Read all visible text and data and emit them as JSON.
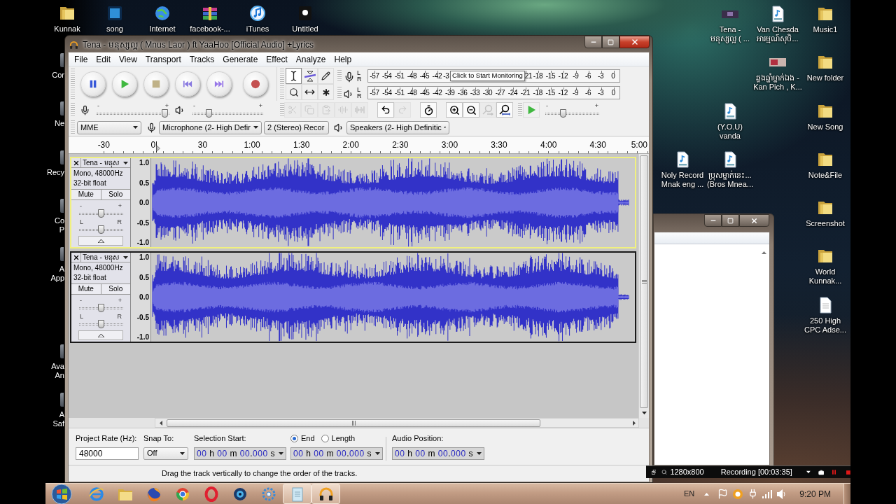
{
  "desktop": {
    "top_icons": [
      {
        "lines": [
          "Kunnak"
        ],
        "kind": "folder"
      },
      {
        "lines": [
          "song"
        ],
        "kind": "ps"
      },
      {
        "lines": [
          "Internet"
        ],
        "kind": "globe"
      },
      {
        "lines": [
          "facebook-..."
        ],
        "kind": "archive"
      },
      {
        "lines": [
          "iTunes"
        ],
        "kind": "itunes"
      },
      {
        "lines": [
          "Untitled"
        ],
        "kind": "app"
      }
    ],
    "left_icons": [
      {
        "lines": [
          "Cor"
        ]
      },
      {
        "lines": [
          "Ne"
        ]
      },
      {
        "lines": [
          "Recy"
        ]
      },
      {
        "lines": [
          "Co",
          "P"
        ]
      },
      {
        "lines": [
          "A",
          "App"
        ]
      },
      {
        "lines": [
          "Ava",
          "An"
        ]
      },
      {
        "lines": [
          "A",
          "Saf"
        ]
      }
    ],
    "right_icons": [
      {
        "lines": [
          "Tena -",
          "មនុស្សល្អ ( ..."
        ],
        "kind": "video"
      },
      {
        "lines": [
          "Van Chesda",
          "អារម្មណ៍សុបិ..."
        ],
        "kind": "mp3"
      },
      {
        "lines": [
          "Music1"
        ],
        "kind": "folder"
      },
      {
        "lines": [
          "ឆ្លងឆ្នាំម្នាក់ឯង -",
          "Kan Pich , K..."
        ],
        "kind": "image"
      },
      {
        "lines": [
          "New folder"
        ],
        "kind": "folder"
      },
      {
        "lines": [
          "(Y.O.U)",
          "vanda"
        ],
        "kind": "mp3"
      },
      {
        "lines": [
          "New Song"
        ],
        "kind": "folder"
      },
      {
        "lines": [
          "Noly Record",
          "Mnak eng ..."
        ],
        "kind": "mp3"
      },
      {
        "lines": [
          "ប្រុសម្នាក់នេះ...",
          "(Bros Mnea..."
        ],
        "kind": "mp3"
      },
      {
        "lines": [
          "Note&File"
        ],
        "kind": "folder"
      },
      {
        "lines": [
          "Screenshot"
        ],
        "kind": "folder"
      },
      {
        "lines": [
          "World",
          "Kunnak..."
        ],
        "kind": "folder"
      },
      {
        "lines": [
          "250 High",
          "CPC Adse..."
        ],
        "kind": "document"
      }
    ]
  },
  "audacity": {
    "title": "Tena - មនុស្សល្អ ( Mnus Laor ) ft YaaHoo [Official Audio] +Lyrics",
    "menu": [
      "File",
      "Edit",
      "View",
      "Transport",
      "Tracks",
      "Generate",
      "Effect",
      "Analyze",
      "Help"
    ],
    "transport": [
      {
        "kind": "pause"
      },
      {
        "kind": "play"
      },
      {
        "kind": "stop"
      },
      {
        "kind": "skip-start"
      },
      {
        "kind": "skip-end"
      },
      {
        "kind": "record"
      }
    ],
    "tools": [
      {
        "kind": "select",
        "selected": true
      },
      {
        "kind": "envelope",
        "selected": false
      },
      {
        "kind": "draw",
        "selected": false
      },
      {
        "kind": "zoom",
        "selected": false
      },
      {
        "kind": "timeshift",
        "selected": false
      },
      {
        "kind": "multi",
        "selected": false
      }
    ],
    "meters": [
      {
        "kind": "recording",
        "channels": [
          "L",
          "R"
        ],
        "scale": [
          "-57",
          "-54",
          "-51",
          "-48",
          "-45",
          "-42",
          "-3"
        ],
        "tooltip": "Click to Start Monitoring",
        "scale_continued": [
          "21",
          "-18",
          "-15",
          "-12",
          "-9",
          "-6",
          "-3",
          "0"
        ]
      },
      {
        "kind": "playback",
        "channels": [
          "L",
          "R"
        ],
        "scale": [
          "-57",
          "-54",
          "-51",
          "-48",
          "-45",
          "-42",
          "-39",
          "-36",
          "-33",
          "-30",
          "-27",
          "-24",
          "-21",
          "-18",
          "-15",
          "-12",
          "-9",
          "-6",
          "-3",
          "0"
        ]
      }
    ],
    "mixer": {
      "input": {
        "labels": [
          "-",
          "+"
        ],
        "level": 0.98
      },
      "output": {
        "labels": [
          "-",
          "+"
        ],
        "level": 0.21
      }
    },
    "edit_tools": [
      {
        "kind": "cut",
        "disabled": true
      },
      {
        "kind": "copy",
        "disabled": true
      },
      {
        "kind": "paste",
        "disabled": true
      },
      {
        "kind": "trim",
        "disabled": true
      },
      {
        "kind": "silence",
        "disabled": true
      },
      {
        "kind": "undo",
        "disabled": false
      },
      {
        "kind": "redo",
        "disabled": true
      },
      {
        "kind": "sync-lock",
        "disabled": false
      },
      {
        "kind": "zoom-in",
        "disabled": false
      },
      {
        "kind": "zoom-out",
        "disabled": false
      },
      {
        "kind": "fit-selection",
        "disabled": true
      },
      {
        "kind": "fit-project",
        "disabled": false
      }
    ],
    "play_at_speed": {
      "labels": [
        "-",
        "+"
      ],
      "level": 0.31
    },
    "devices": {
      "host": "MME",
      "input": "Microphone (2- High Defir",
      "channels": "2 (Stereo) Recor",
      "output": "Speakers (2- High Definitic"
    },
    "ruler": [
      "-30",
      "0",
      "30",
      "1:00",
      "1:30",
      "2:00",
      "2:30",
      "3:00",
      "3:30",
      "4:00",
      "4:30",
      "5:00"
    ],
    "tracks": [
      {
        "name": "Tena - មនុស",
        "format": "Mono, 48000Hz",
        "sample_format": "32-bit float",
        "mute": "Mute",
        "solo": "Solo",
        "selected": true,
        "gain": {
          "labels": [
            "-",
            "+"
          ],
          "level": 0.5
        },
        "pan": {
          "labels": [
            "L",
            "R"
          ],
          "level": 0.5
        },
        "scale": [
          "1.0",
          "0.5",
          "0.0",
          "-0.5",
          "-1.0"
        ]
      },
      {
        "name": "Tena - មនុស",
        "format": "Mono, 48000Hz",
        "sample_format": "32-bit float",
        "mute": "Mute",
        "solo": "Solo",
        "selected": false,
        "gain": {
          "labels": [
            "-",
            "+"
          ],
          "level": 0.5
        },
        "pan": {
          "labels": [
            "L",
            "R"
          ],
          "level": 0.5
        },
        "scale": [
          "1.0",
          "0.5",
          "0.0",
          "-0.5",
          "-1.0"
        ]
      }
    ],
    "selection_bar": {
      "rate_label": "Project Rate (Hz):",
      "rate": "48000",
      "snap_label": "Snap To:",
      "snap": "Off",
      "start_label": "Selection Start:",
      "start": "00 h 00 m 00.000 s",
      "modes": [
        {
          "label": "End",
          "selected": true
        },
        {
          "label": "Length",
          "selected": false
        }
      ],
      "end": "00 h 00 m 00.000 s",
      "position_label": "Audio Position:",
      "position": "00 h 00 m 00.000 s"
    },
    "status": "Drag the track vertically to change the order of the tracks."
  },
  "recorder_bar": {
    "resolution": "1280x800",
    "status": "Recording [00:03:35]"
  },
  "taskbar": {
    "apps": [
      {
        "kind": "ie",
        "active": false
      },
      {
        "kind": "explorer",
        "active": false
      },
      {
        "kind": "firefox",
        "active": false
      },
      {
        "kind": "chrome",
        "active": false
      },
      {
        "kind": "opera",
        "active": false
      },
      {
        "kind": "media",
        "active": false
      },
      {
        "kind": "network",
        "active": false
      },
      {
        "kind": "notepad",
        "active": true
      },
      {
        "kind": "audacity",
        "active": true
      }
    ],
    "language": "EN",
    "time": "9:20 PM"
  }
}
